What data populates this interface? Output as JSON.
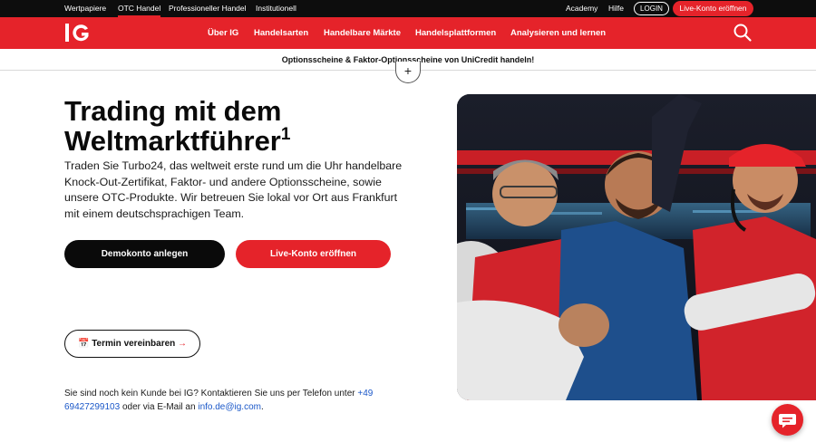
{
  "topbar": {
    "tabs": [
      "Wertpapiere",
      "OTC Handel",
      "Professioneller Handel",
      "Institutionell"
    ],
    "active_tab": "OTC Handel",
    "links": [
      "Academy",
      "Hilfe"
    ],
    "login_label": "LOGIN",
    "live_label": "Live-Konto eröffnen"
  },
  "nav": {
    "logo": "IG",
    "items": [
      "Über IG",
      "Handelsarten",
      "Handelbare Märkte",
      "Handelsplattformen",
      "Analysieren und lernen"
    ],
    "search_icon": "search-icon"
  },
  "promo": {
    "text": "Optionsscheine & Faktor-Optionsscheine von UniCredit handeln!",
    "expand_symbol": "+"
  },
  "hero": {
    "headline_line1": "Trading mit dem",
    "headline_line2": "Weltmarktführer",
    "headline_sup": "1",
    "description": "Traden Sie Turbo24, das weltweit erste rund um die Uhr handelbare Knock-Out-Zertifikat, Faktor- und andere Optionsscheine, sowie unsere OTC-Produkte. Wir betreuen Sie lokal vor Ort aus Frankfurt mit einem deutschsprachigen Team.",
    "demo_button": "Demokonto anlegen",
    "live_button": "Live-Konto eröffnen",
    "termin_icon": "📅",
    "termin_label": "Termin vereinbaren",
    "termin_arrow": "→",
    "contact_prefix": "Sie sind noch kein Kunde bei IG? Kontaktieren Sie uns per Telefon unter ",
    "contact_phone": "+49 69427299103",
    "contact_middle": " oder via E-Mail an ",
    "contact_email": "info.de@ig.com",
    "contact_suffix": "."
  },
  "colors": {
    "brand_red": "#e5232a",
    "black": "#0d0d0d",
    "link_blue": "#1a57c8"
  },
  "chat": {
    "icon": "chat-icon"
  }
}
